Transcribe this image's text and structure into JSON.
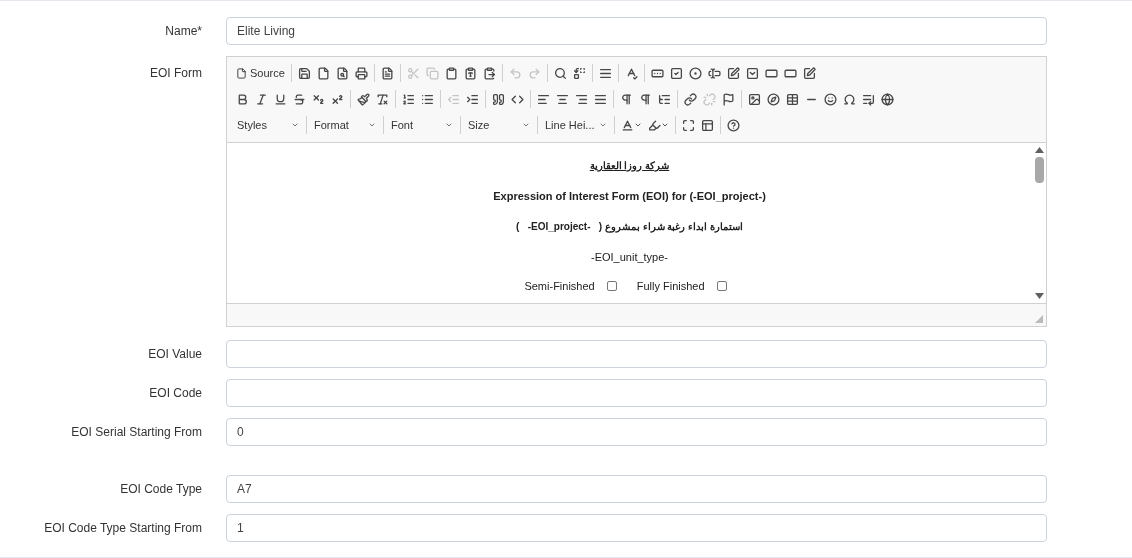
{
  "fields_top": [
    {
      "label": "Name*",
      "value": "Elite Living"
    }
  ],
  "editor": {
    "label": "EOI Form",
    "source_label": "Source",
    "dropdowns": [
      {
        "label": "Styles"
      },
      {
        "label": "Format"
      },
      {
        "label": "Font"
      },
      {
        "label": "Size"
      },
      {
        "label": "Line Hei..."
      }
    ],
    "content": {
      "company": "شركة روزا العقارية",
      "title": "Expression of Interest Form (EOI) for (-EOI_project-)",
      "arabic_line": "استمارة ابداء رغبة شراء بمشروع (   -EOI_project-   )",
      "unit_type": "-EOI_unit_type-",
      "options": [
        {
          "label": "Semi-Finished",
          "checked": false
        },
        {
          "label": "Fully Finished",
          "checked": false
        }
      ]
    }
  },
  "fields": [
    {
      "label": "EOI Value"
    },
    {
      "label": "EOI Code"
    },
    {
      "label": "EOI Serial Starting From",
      "value": "0"
    }
  ],
  "fields_lower": [
    {
      "label": "EOI Code Type",
      "value": "A7"
    },
    {
      "label": "EOI Code Type Starting From",
      "value": "1"
    }
  ]
}
